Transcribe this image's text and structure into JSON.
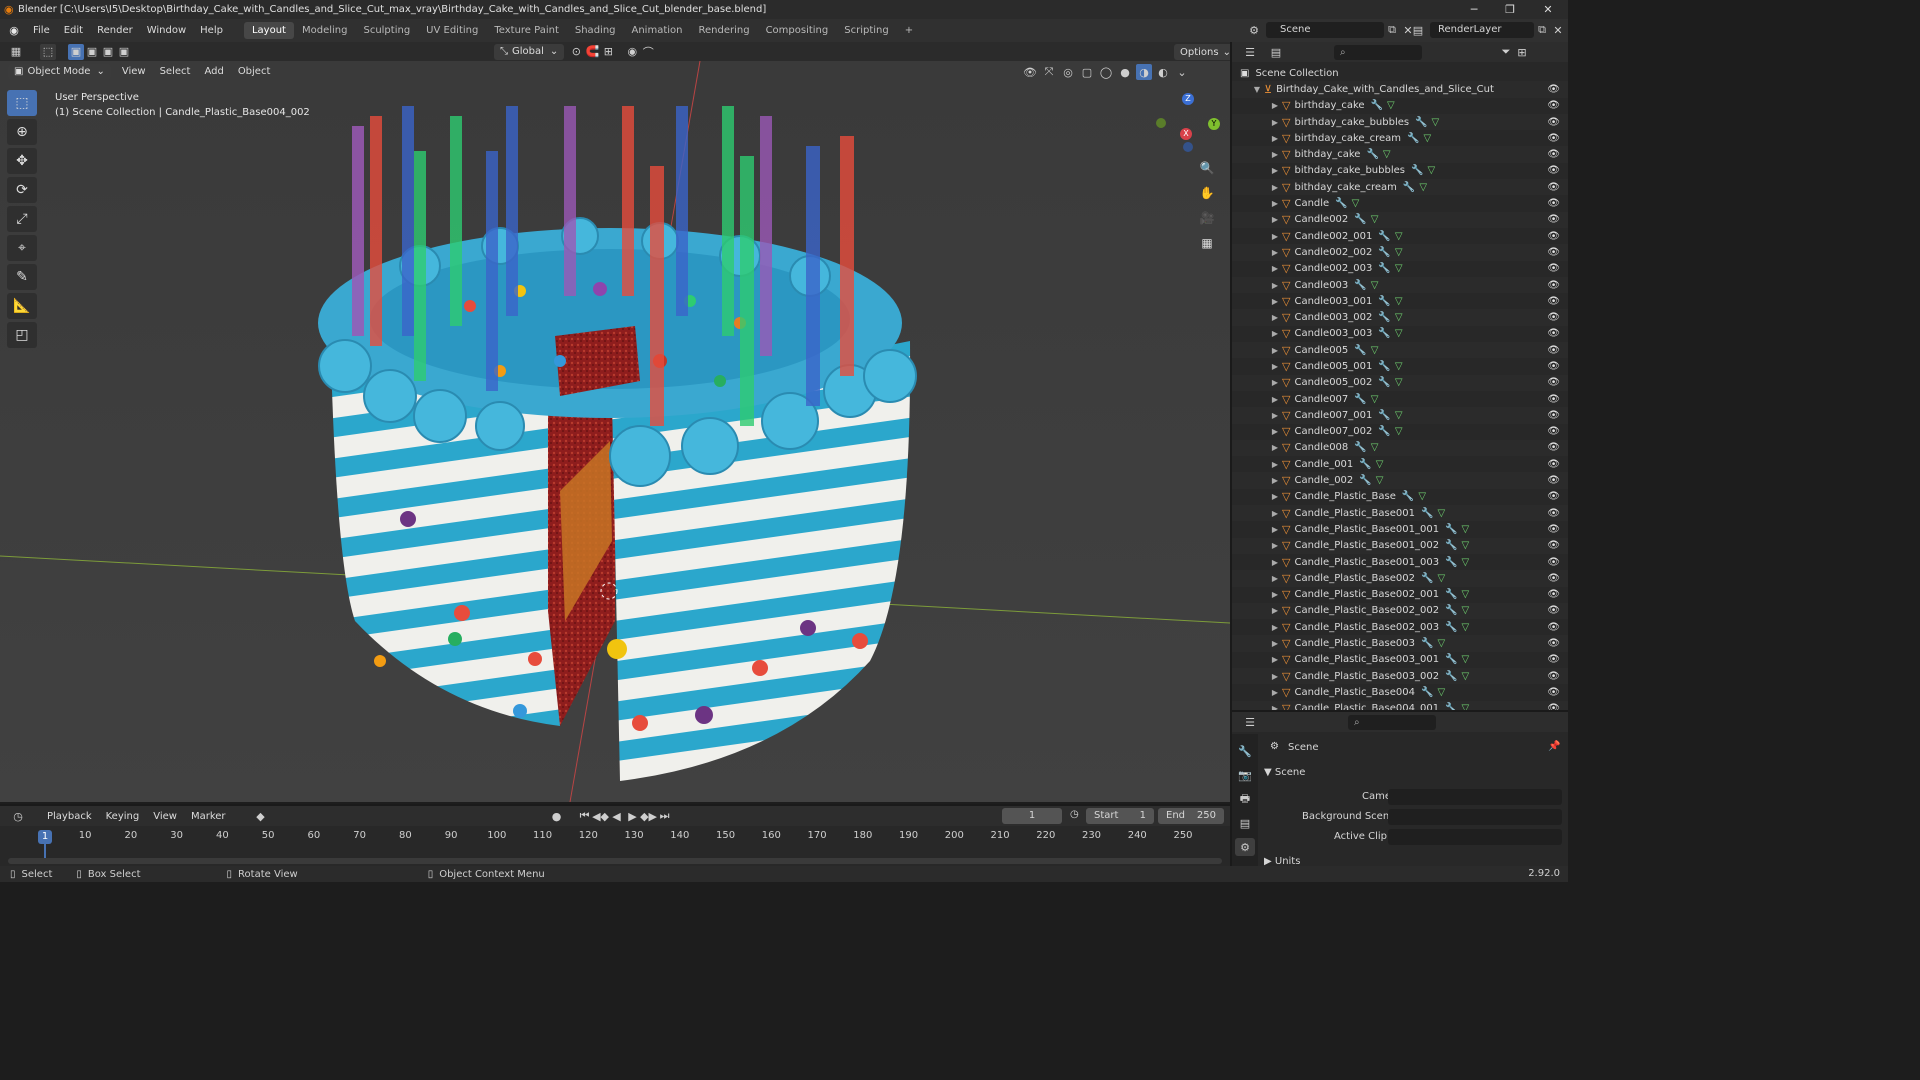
{
  "title": "Blender [C:\\Users\\I5\\Desktop\\Birthday_Cake_with_Candles_and_Slice_Cut_max_vray\\Birthday_Cake_with_Candles_and_Slice_Cut_blender_base.blend]",
  "menu": [
    "File",
    "Edit",
    "Render",
    "Window",
    "Help"
  ],
  "workspaces": [
    "Layout",
    "Modeling",
    "Sculpting",
    "UV Editing",
    "Texture Paint",
    "Shading",
    "Animation",
    "Rendering",
    "Compositing",
    "Scripting"
  ],
  "active_workspace": "Layout",
  "scene_name": "Scene",
  "render_layer": "RenderLayer",
  "viewport": {
    "mode": "Object Mode",
    "menus": [
      "View",
      "Select",
      "Add",
      "Object"
    ],
    "orientation": "Global",
    "options": "Options",
    "perspective": "User Perspective",
    "collection_info": "(1) Scene Collection | Candle_Plastic_Base004_002",
    "gizmo": {
      "z": "Z",
      "y": "Y",
      "x": "X"
    }
  },
  "outliner": {
    "root": "Scene Collection",
    "collection": "Birthday_Cake_with_Candles_and_Slice_Cut",
    "items": [
      "birthday_cake",
      "birthday_cake_bubbles",
      "birthday_cake_cream",
      "bithday_cake",
      "bithday_cake_bubbles",
      "bithday_cake_cream",
      "Candle",
      "Candle002",
      "Candle002_001",
      "Candle002_002",
      "Candle002_003",
      "Candle003",
      "Candle003_001",
      "Candle003_002",
      "Candle003_003",
      "Candle005",
      "Candle005_001",
      "Candle005_002",
      "Candle007",
      "Candle007_001",
      "Candle007_002",
      "Candle008",
      "Candle_001",
      "Candle_002",
      "Candle_Plastic_Base",
      "Candle_Plastic_Base001",
      "Candle_Plastic_Base001_001",
      "Candle_Plastic_Base001_002",
      "Candle_Plastic_Base001_003",
      "Candle_Plastic_Base002",
      "Candle_Plastic_Base002_001",
      "Candle_Plastic_Base002_002",
      "Candle_Plastic_Base002_003",
      "Candle_Plastic_Base003",
      "Candle_Plastic_Base003_001",
      "Candle_Plastic_Base003_002",
      "Candle_Plastic_Base004",
      "Candle_Plastic_Base004_001"
    ]
  },
  "properties": {
    "header": "Scene",
    "section": "Scene",
    "camera_label": "Camera",
    "background_label": "Background Scene",
    "clip_label": "Active Clip",
    "units_label": "Units"
  },
  "timeline": {
    "menus": [
      "Playback",
      "Keying",
      "View",
      "Marker"
    ],
    "current_frame": "1",
    "start_label": "Start",
    "start": "1",
    "end_label": "End",
    "end": "250",
    "ticks": [
      "1",
      "10",
      "20",
      "30",
      "40",
      "50",
      "60",
      "70",
      "80",
      "90",
      "100",
      "110",
      "120",
      "130",
      "140",
      "150",
      "160",
      "170",
      "180",
      "190",
      "200",
      "210",
      "220",
      "230",
      "240",
      "250"
    ]
  },
  "status": {
    "select": "Select",
    "box_select": "Box Select",
    "rotate": "Rotate View",
    "context": "Object Context Menu",
    "version": "2.92.0"
  }
}
